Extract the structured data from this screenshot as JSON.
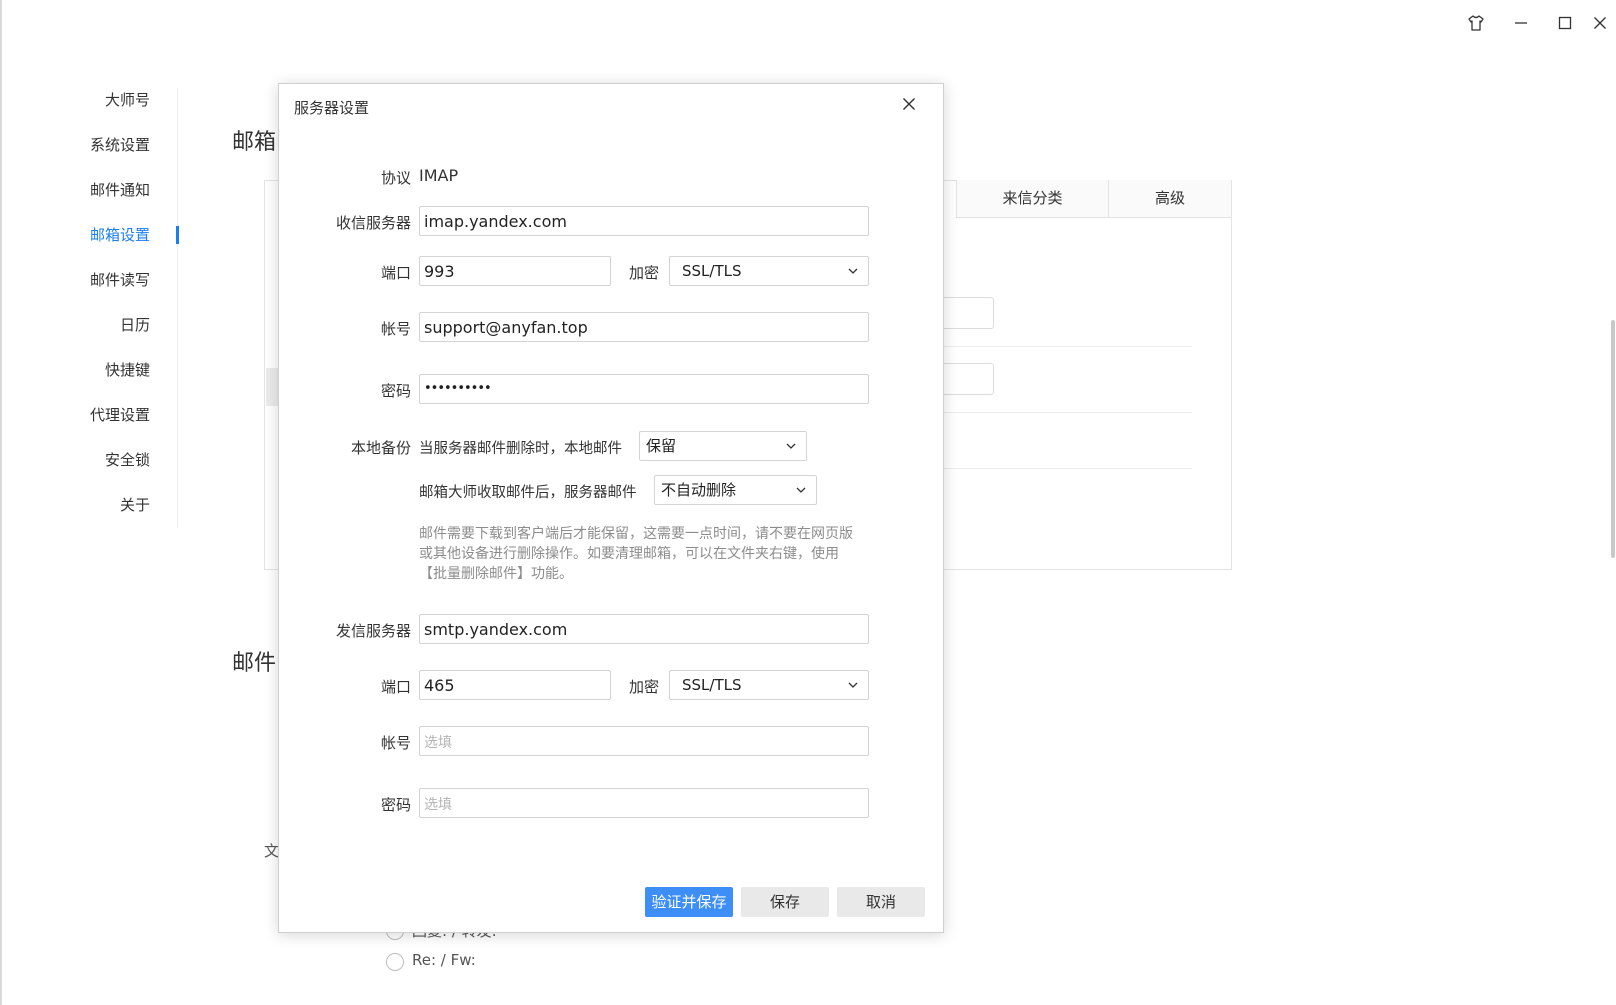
{
  "window": {
    "controls": [
      "skin-icon",
      "minimize-icon",
      "maximize-icon",
      "close-icon"
    ]
  },
  "nav": {
    "items": [
      {
        "label": "大师号"
      },
      {
        "label": "系统设置"
      },
      {
        "label": "邮件通知"
      },
      {
        "label": "邮箱设置",
        "active": true
      },
      {
        "label": "邮件读写"
      },
      {
        "label": "日历"
      },
      {
        "label": "快捷键"
      },
      {
        "label": "代理设置"
      },
      {
        "label": "安全锁"
      },
      {
        "label": "关于"
      }
    ],
    "accent_color": "#1a7ef2"
  },
  "background": {
    "section1_title": "邮箱",
    "section2_title": "邮件",
    "table_headers": [
      "来信分类",
      "高级"
    ],
    "label_text": "文",
    "radio_1": "回复: / 转发:",
    "radio_2": "Re: / Fw:"
  },
  "dialog": {
    "title": "服务器设置",
    "protocol_label": "协议",
    "protocol_value": "IMAP",
    "incoming": {
      "server_label": "收信服务器",
      "server_value": "imap.yandex.com",
      "port_label": "端口",
      "port_value": "993",
      "encrypt_label": "加密",
      "encrypt_value": "SSL/TLS",
      "account_label": "帐号",
      "account_value": "support@anyfan.top",
      "password_label": "密码",
      "password_value": "••••••••••"
    },
    "backup": {
      "label": "本地备份",
      "rule1_text": "当服务器邮件删除时，本地邮件",
      "rule1_value": "保留",
      "rule2_text": "邮箱大师收取邮件后，服务器邮件",
      "rule2_value": "不自动删除",
      "note": "邮件需要下载到客户端后才能保留，这需要一点时间，请不要在网页版或其他设备进行删除操作。如要清理邮箱，可以在文件夹右键，使用【批量删除邮件】功能。"
    },
    "outgoing": {
      "server_label": "发信服务器",
      "server_value": "smtp.yandex.com",
      "port_label": "端口",
      "port_value": "465",
      "encrypt_label": "加密",
      "encrypt_value": "SSL/TLS",
      "account_label": "帐号",
      "account_placeholder": "选填",
      "password_label": "密码",
      "password_placeholder": "选填"
    },
    "buttons": {
      "verify_save": "验证并保存",
      "save": "保存",
      "cancel": "取消"
    },
    "primary_color": "#3d8ef7"
  }
}
